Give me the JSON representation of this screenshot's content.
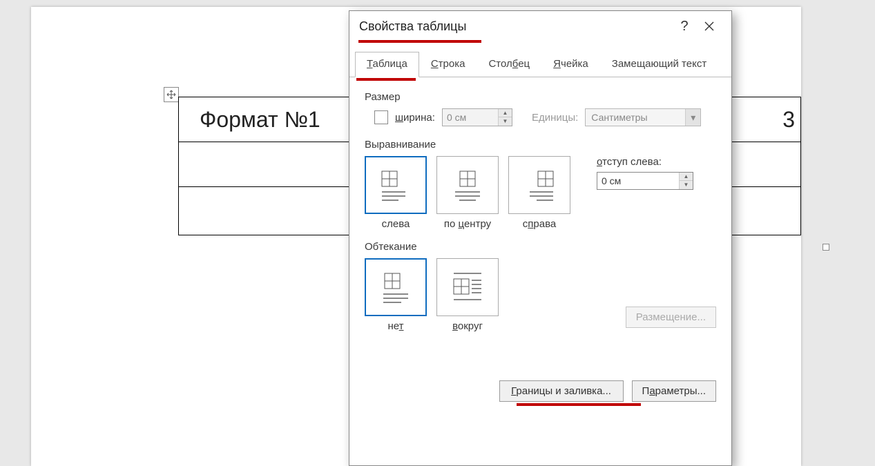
{
  "doc": {
    "cell1": "Формат №1",
    "cell3_tail": "3"
  },
  "dialog": {
    "title": "Свойства таблицы",
    "tabs": {
      "table": "аблица",
      "table_u": "Т",
      "row": "трока",
      "row_u": "С",
      "col_pre": "Стол",
      "col_u": "б",
      "col_post": "ец",
      "cell_u": "Я",
      "cell": "чейка",
      "alt": "Замещающий текст"
    },
    "size": {
      "label": "Размер",
      "width_u": "ш",
      "width_rest": "ирина:",
      "width_val": "0 см",
      "units_label": "Единицы:",
      "units_val": "Сантиметры"
    },
    "align": {
      "label": "Выравнивание",
      "left": "слева",
      "center_pre": "по ",
      "center_u": "ц",
      "center_post": "ентру",
      "right_pre": "с",
      "right_u": "п",
      "right_post": "рава",
      "indent_pre": "",
      "indent_u": "о",
      "indent_post": "тступ слева:",
      "indent_val": "0 см"
    },
    "wrap": {
      "label": "Обтекание",
      "none_pre": "не",
      "none_u": "т",
      "around_u": "в",
      "around_post": "округ",
      "position": "Размещение..."
    },
    "buttons": {
      "borders_u": "Г",
      "borders_rest": "раницы и заливка...",
      "params_pre": "П",
      "params_u": "а",
      "params_post": "раметры..."
    }
  }
}
